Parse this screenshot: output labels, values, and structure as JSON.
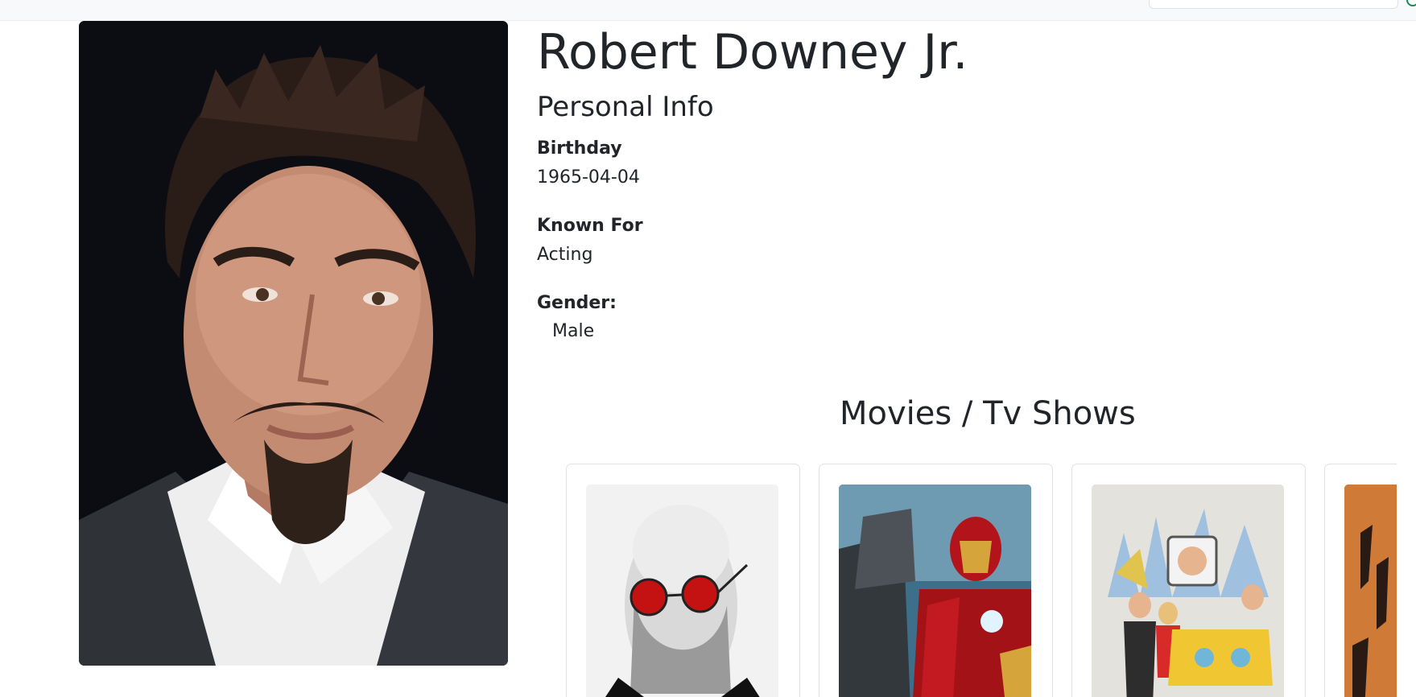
{
  "profile": {
    "name": "Robert Downey Jr.",
    "section_heading": "Personal Info",
    "birthday_label": "Birthday",
    "birthday": "1965-04-04",
    "known_for_label": "Known For",
    "known_for": "Acting",
    "gender_label": "Gender:",
    "gender": "Male"
  },
  "credits": {
    "heading": "Movies / Tv Shows",
    "cards": [
      {
        "poster": "bald-man-red-sunglasses-poster"
      },
      {
        "poster": "iron-man-armor-poster"
      },
      {
        "poster": "cartoon-taxi-city-poster"
      },
      {
        "poster": "orange-shadow-figures-poster"
      }
    ]
  },
  "colors": {
    "text": "#212529",
    "card_border": "#dfe2e6",
    "search_accent": "#198754"
  }
}
